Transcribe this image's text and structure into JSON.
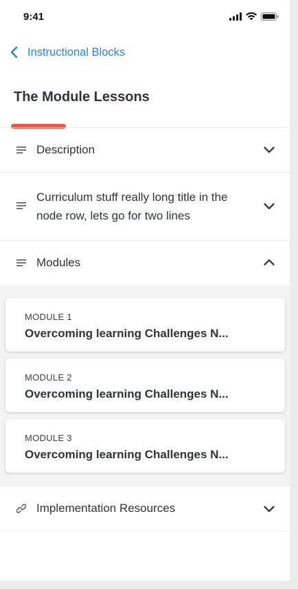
{
  "status_bar": {
    "time": "9:41"
  },
  "nav": {
    "back_label": "Instructional Blocks"
  },
  "page": {
    "title": "The Module Lessons"
  },
  "sections": {
    "description": {
      "label": "Description",
      "state": "collapsed"
    },
    "curriculum": {
      "label": "Curriculum stuff really long title in the node row, lets go for two lines",
      "state": "collapsed"
    },
    "modules": {
      "label": "Modules",
      "state": "expanded"
    },
    "resources": {
      "label": "Implementation Resources",
      "state": "collapsed"
    }
  },
  "modules": [
    {
      "kicker": "MODULE 1",
      "title": "Overcoming learning Challenges N..."
    },
    {
      "kicker": "MODULE 2",
      "title": "Overcoming learning Challenges N..."
    },
    {
      "kicker": "MODULE 3",
      "title": "Overcoming learning Challenges N..."
    }
  ],
  "colors": {
    "accent_blue": "#2f80d8",
    "tab_underline": "#ea5a4c",
    "text": "#2f3437",
    "panel_bg": "#f3f3f3"
  },
  "icons": {
    "back": "chevron-left-icon",
    "row": "lines-icon",
    "collapsed": "chevron-down-icon",
    "expanded": "chevron-up-icon",
    "resources": "link-icon"
  }
}
